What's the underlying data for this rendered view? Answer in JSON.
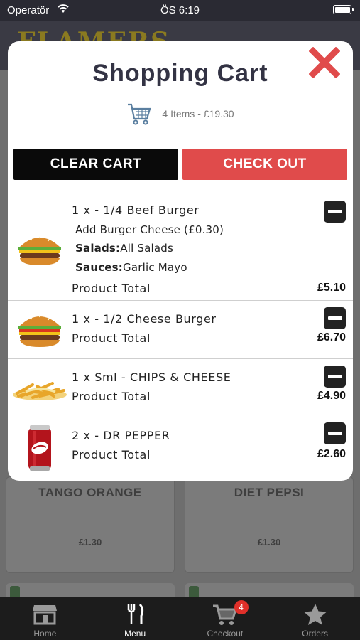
{
  "status_bar": {
    "carrier": "Operatör",
    "time": "ÖS 6:19"
  },
  "app": {
    "logo": "FLAMERS"
  },
  "background_menu": {
    "cards": [
      {
        "name": "TANGO ORANGE",
        "price": "£1.30"
      },
      {
        "name": "DIET PEPSI",
        "price": "£1.30"
      }
    ]
  },
  "cart": {
    "title": "Shopping Cart",
    "summary": "4 Items - £19.30",
    "clear_label": "CLEAR CART",
    "checkout_label": "CHECK OUT",
    "items": [
      {
        "title": "1 x - 1/4 Beef Burger",
        "extra": "Add Burger Cheese (£0.30)",
        "salads_label": "Salads:",
        "salads_value": "All Salads",
        "sauces_label": "Sauces:",
        "sauces_value": "Garlic Mayo",
        "total_label": "Product Total",
        "price": "£5.10",
        "image": "burger-icon"
      },
      {
        "title": "1 x - 1/2 Cheese Burger",
        "total_label": "Product Total",
        "price": "£6.70",
        "image": "burger-icon"
      },
      {
        "title": "1 x Sml - CHIPS & CHEESE",
        "total_label": "Product Total",
        "price": "£4.90",
        "image": "chips-icon"
      },
      {
        "title": "2 x - DR PEPPER",
        "total_label": "Product Total",
        "price": "£2.60",
        "image": "soda-can-icon"
      }
    ]
  },
  "tabbar": {
    "tabs": [
      {
        "label": "Home",
        "icon": "store-icon"
      },
      {
        "label": "Menu",
        "icon": "fork-knife-icon",
        "active": true
      },
      {
        "label": "Checkout",
        "icon": "cart-icon",
        "badge": "4"
      },
      {
        "label": "Orders",
        "icon": "star-icon"
      }
    ]
  },
  "colors": {
    "checkout": "#e04b4b",
    "clear": "#0a0a0a",
    "close": "#e04b4b",
    "badge": "#e0302a"
  }
}
